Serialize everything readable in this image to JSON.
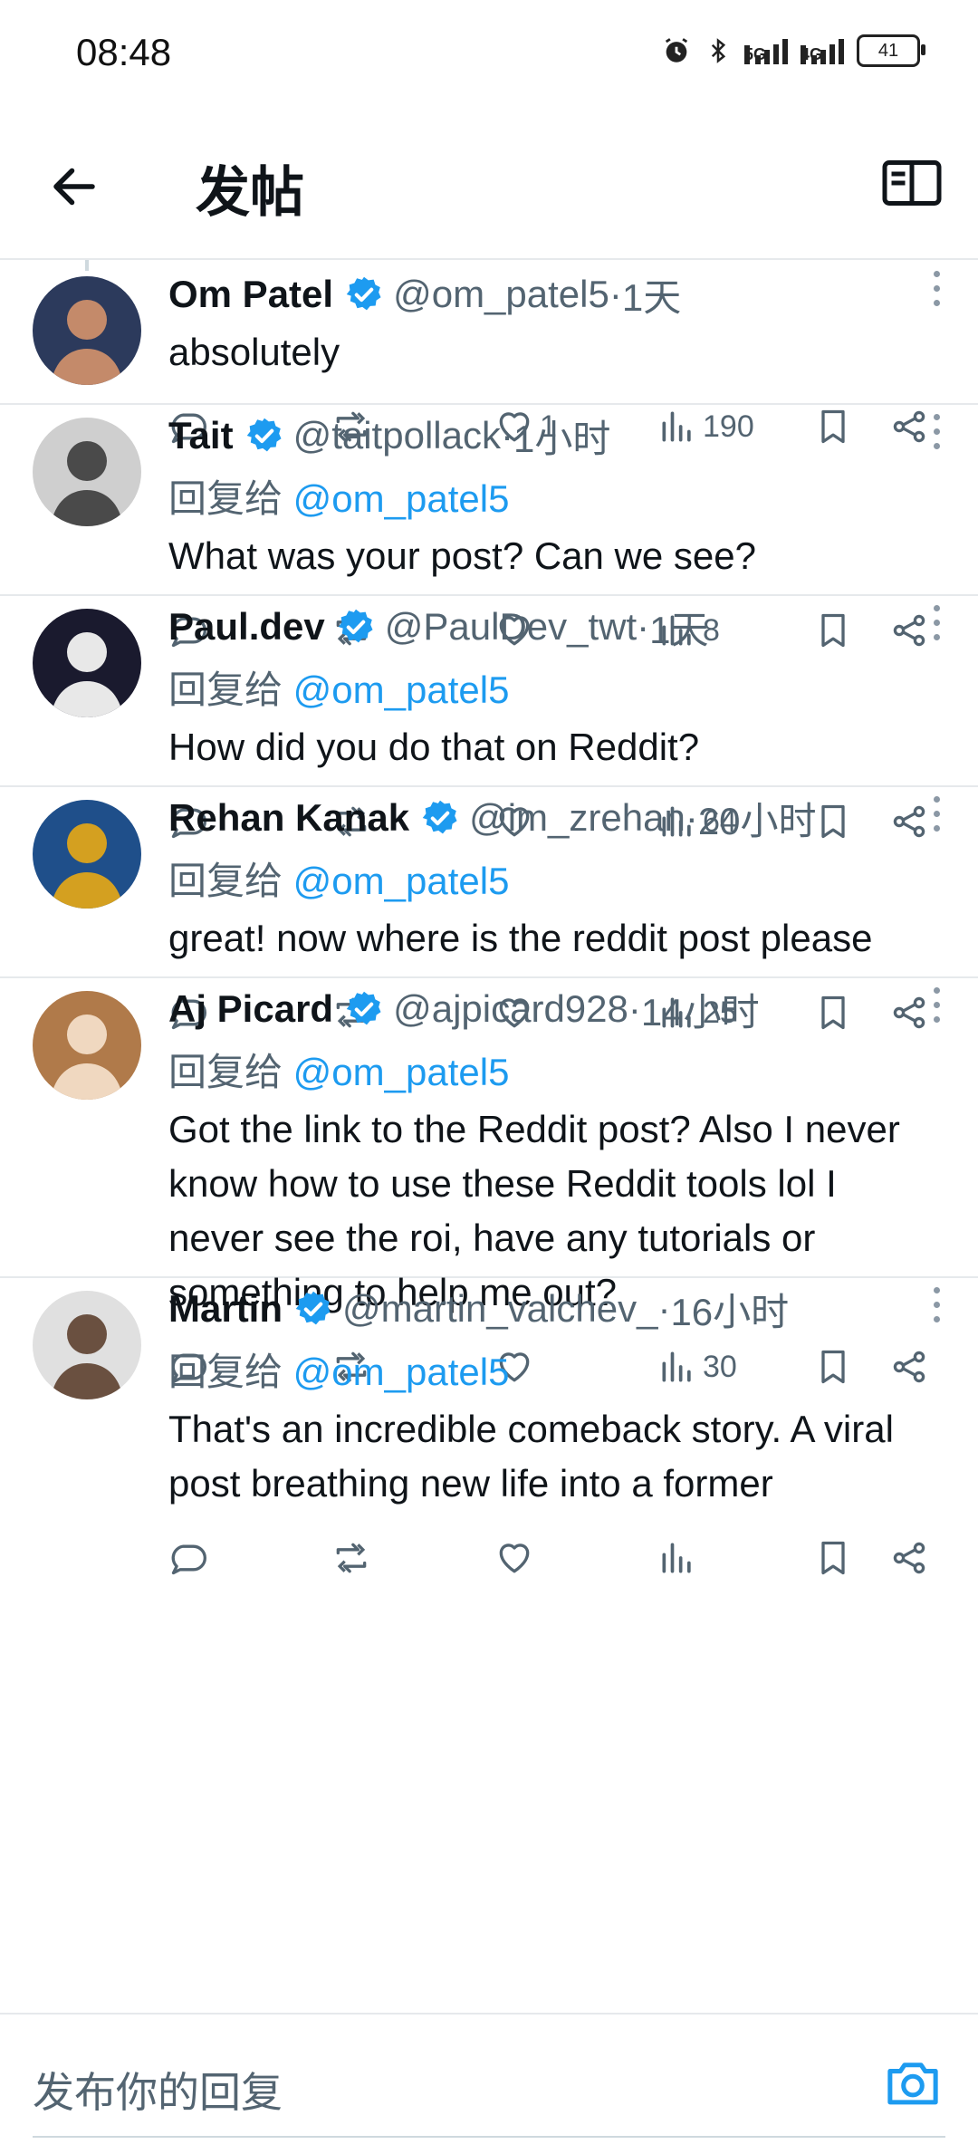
{
  "status": {
    "time": "08:48",
    "battery": "41",
    "net1": "5G",
    "net2": "4G"
  },
  "header": {
    "title": "发帖"
  },
  "replies": [
    {
      "name": "Om Patel",
      "handle": "@om_patel5",
      "time": "1天",
      "replying_to": "",
      "text": "absolutely",
      "likes": "1",
      "views": "190"
    },
    {
      "name": "Tait",
      "handle": "@taitpollack",
      "time": "1小时",
      "replying_to": "@om_patel5",
      "text": "What was your post? Can we see?",
      "likes": "",
      "views": "8"
    },
    {
      "name": "Paul.dev",
      "handle": "@PaulDev_twt",
      "time": "1天",
      "replying_to": "@om_patel5",
      "text": "How did you do that on Reddit?",
      "likes": "",
      "views": "64"
    },
    {
      "name": "Rehan Kanak",
      "handle": "@im_zrehan",
      "time": "20小时",
      "replying_to": "@om_patel5",
      "text": "great! now where is the reddit post please",
      "likes": "",
      "views": "25"
    },
    {
      "name": "Aj Picard",
      "handle": "@ajpicard928",
      "time": "14小时",
      "replying_to": "@om_patel5",
      "text": "Got the link to the Reddit post? Also I never know how to use these Reddit tools lol I never see the roi, have any tutorials or something to help me out?",
      "likes": "",
      "views": "30"
    },
    {
      "name": "Martin",
      "handle": "@martin_valchev_",
      "time": "16小时",
      "replying_to": "@om_patel5",
      "text": "That's an incredible comeback story. A viral post breathing new life into a former",
      "likes": "",
      "views": ""
    }
  ],
  "labels": {
    "replying_prefix": "回复给 ",
    "dot": " · "
  },
  "compose": {
    "placeholder": "发布你的回复"
  },
  "colors": {
    "accent": "#1d9bf0",
    "muted": "#536471",
    "divider": "#e6e9ec"
  }
}
